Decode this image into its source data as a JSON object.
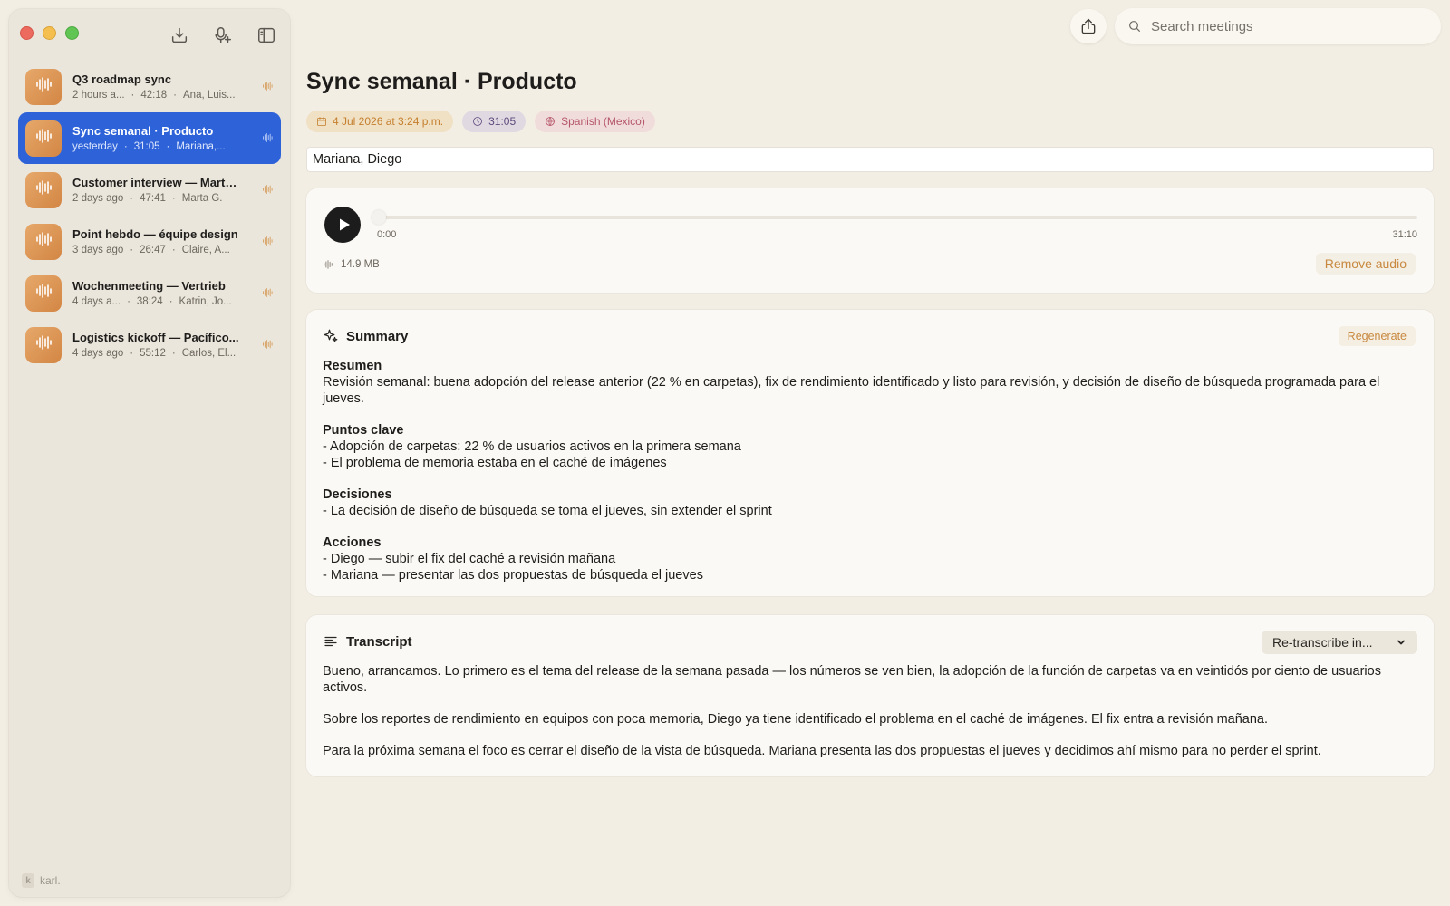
{
  "sidebar": {
    "meetings": [
      {
        "title": "Q3 roadmap sync",
        "when": "2 hours a...",
        "duration": "42:18",
        "people": "Ana, Luis...",
        "active": false
      },
      {
        "title": "Sync semanal · Producto",
        "when": "yesterday",
        "duration": "31:05",
        "people": "Mariana,...",
        "active": true
      },
      {
        "title": "Customer interview — Marta...",
        "when": "2 days ago",
        "duration": "47:41",
        "people": "Marta G.",
        "active": false
      },
      {
        "title": "Point hebdo — équipe design",
        "when": "3 days ago",
        "duration": "26:47",
        "people": "Claire, A...",
        "active": false
      },
      {
        "title": "Wochenmeeting — Vertrieb",
        "when": "4 days a...",
        "duration": "38:24",
        "people": "Katrin, Jo...",
        "active": false
      },
      {
        "title": "Logistics kickoff — Pacífico...",
        "when": "4 days ago",
        "duration": "55:12",
        "people": "Carlos, El...",
        "active": false
      }
    ],
    "separator": "·",
    "brand": "karl.",
    "brand_mark": "k"
  },
  "search": {
    "placeholder": "Search meetings"
  },
  "meeting": {
    "title": "Sync semanal · Producto",
    "date_chip": "4 Jul 2026 at 3:24 p.m.",
    "duration_chip": "31:05",
    "language_chip": "Spanish (Mexico)",
    "participants": "Mariana, Diego"
  },
  "audio": {
    "current_time": "0:00",
    "total_time": "31:10",
    "progress": 0,
    "file_size": "14.9 MB",
    "remove_label": "Remove audio"
  },
  "summary": {
    "heading": "Summary",
    "regenerate_label": "Regenerate",
    "sections": [
      {
        "title": "Resumen",
        "lines": [
          "Revisión semanal: buena adopción del release anterior (22 % en carpetas), fix de rendimiento identificado y listo para revisión, y decisión de diseño de búsqueda programada para el jueves."
        ]
      },
      {
        "title": "Puntos clave",
        "lines": [
          "- Adopción de carpetas: 22 % de usuarios activos en la primera semana",
          "- El problema de memoria estaba en el caché de imágenes"
        ]
      },
      {
        "title": "Decisiones",
        "lines": [
          "- La decisión de diseño de búsqueda se toma el jueves, sin extender el sprint"
        ]
      },
      {
        "title": "Acciones",
        "lines": [
          "- Diego — subir el fix del caché a revisión mañana",
          "- Mariana — presentar las dos propuestas de búsqueda el jueves"
        ]
      }
    ]
  },
  "transcript": {
    "heading": "Transcript",
    "retranscribe_label": "Re-transcribe in...",
    "paragraphs": [
      "Bueno, arrancamos. Lo primero es el tema del release de la semana pasada — los números se ven bien, la adopción de la función de carpetas va en veintidós por ciento de usuarios activos.",
      "Sobre los reportes de rendimiento en equipos con poca memoria, Diego ya tiene identificado el problema en el caché de imágenes. El fix entra a revisión mañana.",
      "Para la próxima semana el foco es cerrar el diseño de la vista de búsqueda. Mariana presenta las dos propuestas el jueves y decidimos ahí mismo para no perder el sprint."
    ]
  },
  "colors": {
    "accent_blue": "#2e62d9",
    "accent_orange": "#c8883f",
    "background": "#f3eee4",
    "sidebar": "#ebe6dc"
  }
}
